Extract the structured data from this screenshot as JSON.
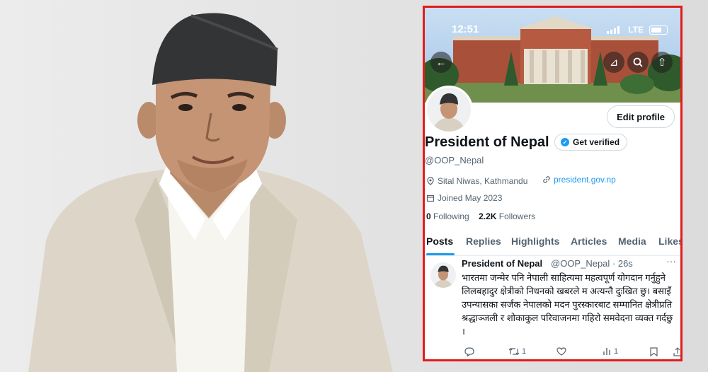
{
  "status_bar": {
    "time": "12:51",
    "network": "LTE"
  },
  "profile": {
    "name": "President of Nepal",
    "verified_label": "Get verified",
    "handle": "@OOP_Nepal",
    "edit_button": "Edit profile",
    "location": "Sital Niwas, Kathmandu",
    "website": "president.gov.np",
    "joined": "Joined May 2023",
    "following_count": "0",
    "following_label": "Following",
    "followers_count": "2.2K",
    "followers_label": "Followers"
  },
  "tabs": [
    "Posts",
    "Replies",
    "Highlights",
    "Articles",
    "Media",
    "Likes"
  ],
  "tweet": {
    "author": "President of Nepal",
    "handle_time": "@OOP_Nepal · 26s",
    "more": "···",
    "body": "भारतमा जन्मेर पनि नेपाली साहित्यमा महत्वपूर्ण योगदान गर्नुहुने लिलबहादुर  क्षेत्रीको निधनको खबरले म अत्यन्तै दुःखित छु। बसाइँ उपन्यासका सर्जक नेपालको मदन पुरस्कारबाट सम्मानित क्षेत्रीप्रति श्रद्धाञ्जली र शोकाकुल परिवाजनमा गहिरो समवेदना व्यक्त गर्दछु ।",
    "retweets": "1",
    "views": "1"
  },
  "icons": [
    "back-arrow-icon",
    "grok-icon",
    "search-icon",
    "share-icon",
    "location-icon",
    "link-icon",
    "calendar-icon",
    "reply-icon",
    "retweet-icon",
    "like-icon",
    "views-icon",
    "bookmark-icon",
    "upload-icon",
    "verified-badge-icon"
  ],
  "colors": {
    "frame": "#e21b1b",
    "accent": "#1d9bf0",
    "text": "#0f1419",
    "muted": "#536471"
  }
}
